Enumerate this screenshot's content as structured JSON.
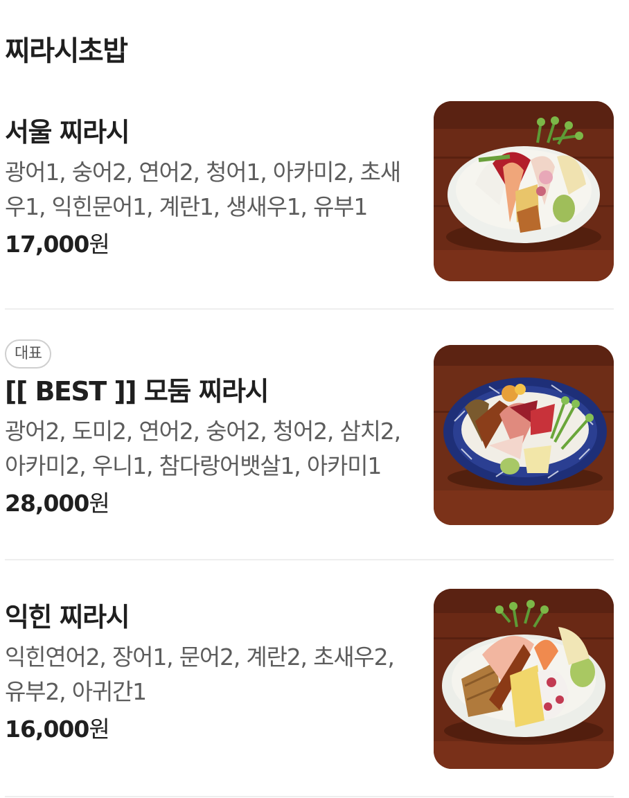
{
  "section_title": "찌라시초밥",
  "items": [
    {
      "name": "서울 찌라시",
      "description": "광어1, 숭어2, 연어2, 청어1, 아카미2, 초새우1, 익힌문어1, 계란1, 생새우1, 유부1",
      "price": "17,000",
      "currency": "원",
      "badge": null
    },
    {
      "name": "[[ BEST ]] 모둠 찌라시",
      "description": "광어2, 도미2, 연어2, 숭어2, 청어2, 삼치2, 아카미2, 우니1, 참다랑어뱃살1, 아카미1",
      "price": "28,000",
      "currency": "원",
      "badge": "대표"
    },
    {
      "name": "익힌 찌라시",
      "description": "익힌연어2, 장어1, 문어2, 계란2, 초새우2, 유부2, 아귀간1",
      "price": "16,000",
      "currency": "원",
      "badge": null
    }
  ],
  "colors": {
    "text_primary": "#1f1f1f",
    "text_secondary": "#5c5c5c",
    "divider": "#eeeeee",
    "badge_border": "#cfcfcf",
    "table_wood": "#6b2a16"
  },
  "icons": {
    "item_1_image": "white-bowl-sashimi-rice-photo",
    "item_2_image": "blue-pattern-bowl-sashimi-rice-photo",
    "item_3_image": "white-bowl-cooked-seafood-rice-photo"
  }
}
